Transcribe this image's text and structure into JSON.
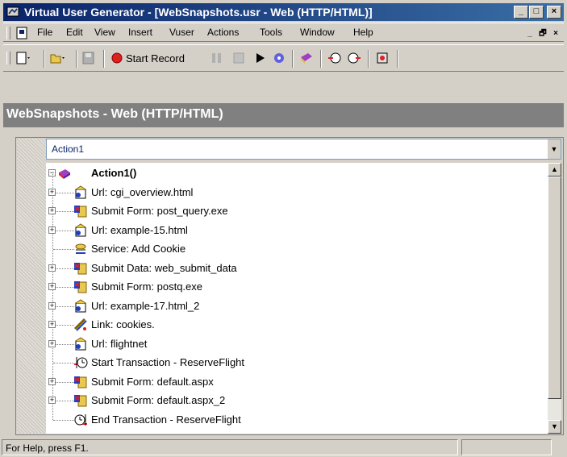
{
  "window": {
    "title": "Virtual User Generator - [WebSnapshots.usr - Web (HTTP/HTML)]",
    "controls": {
      "minimize": "_",
      "maximize": "□",
      "close": "×"
    }
  },
  "menubar": {
    "items": [
      "File",
      "Edit",
      "View",
      "Insert",
      "Vuser",
      "Actions",
      "Tools",
      "Window",
      "Help"
    ],
    "mdi_controls": {
      "minimize": "_",
      "restore": "🗗",
      "close": "×"
    }
  },
  "toolbar": {
    "start_record_label": "Start Record"
  },
  "document": {
    "header": "WebSnapshots - Web (HTTP/HTML)"
  },
  "action_selector": {
    "value": "Action1"
  },
  "tree": {
    "root_label": "Action1()",
    "items": [
      {
        "label": "Url: cgi_overview.html",
        "icon": "url-icon",
        "expandable": true
      },
      {
        "label": "Submit Form: post_query.exe",
        "icon": "submit-form-icon",
        "expandable": true
      },
      {
        "label": "Url: example-15.html",
        "icon": "url-icon",
        "expandable": true
      },
      {
        "label": "Service: Add Cookie",
        "icon": "service-icon",
        "expandable": false
      },
      {
        "label": "Submit Data: web_submit_data",
        "icon": "submit-form-icon",
        "expandable": true
      },
      {
        "label": "Submit Form: postq.exe",
        "icon": "submit-form-icon",
        "expandable": true
      },
      {
        "label": "Url: example-17.html_2",
        "icon": "url-icon",
        "expandable": true
      },
      {
        "label": "Link: cookies.",
        "icon": "link-icon",
        "expandable": true
      },
      {
        "label": "Url: flightnet",
        "icon": "url-icon",
        "expandable": true
      },
      {
        "label": "Start Transaction - ReserveFlight",
        "icon": "start-transaction-icon",
        "expandable": false
      },
      {
        "label": "Submit Form: default.aspx",
        "icon": "submit-form-icon",
        "expandable": true
      },
      {
        "label": "Submit Form: default.aspx_2",
        "icon": "submit-form-icon",
        "expandable": true
      },
      {
        "label": "End Transaction - ReserveFlight",
        "icon": "end-transaction-icon",
        "expandable": false
      }
    ]
  },
  "statusbar": {
    "text": "For Help, press F1."
  },
  "colors": {
    "title_bar": "#0a246a",
    "record_button": "#e02020"
  }
}
